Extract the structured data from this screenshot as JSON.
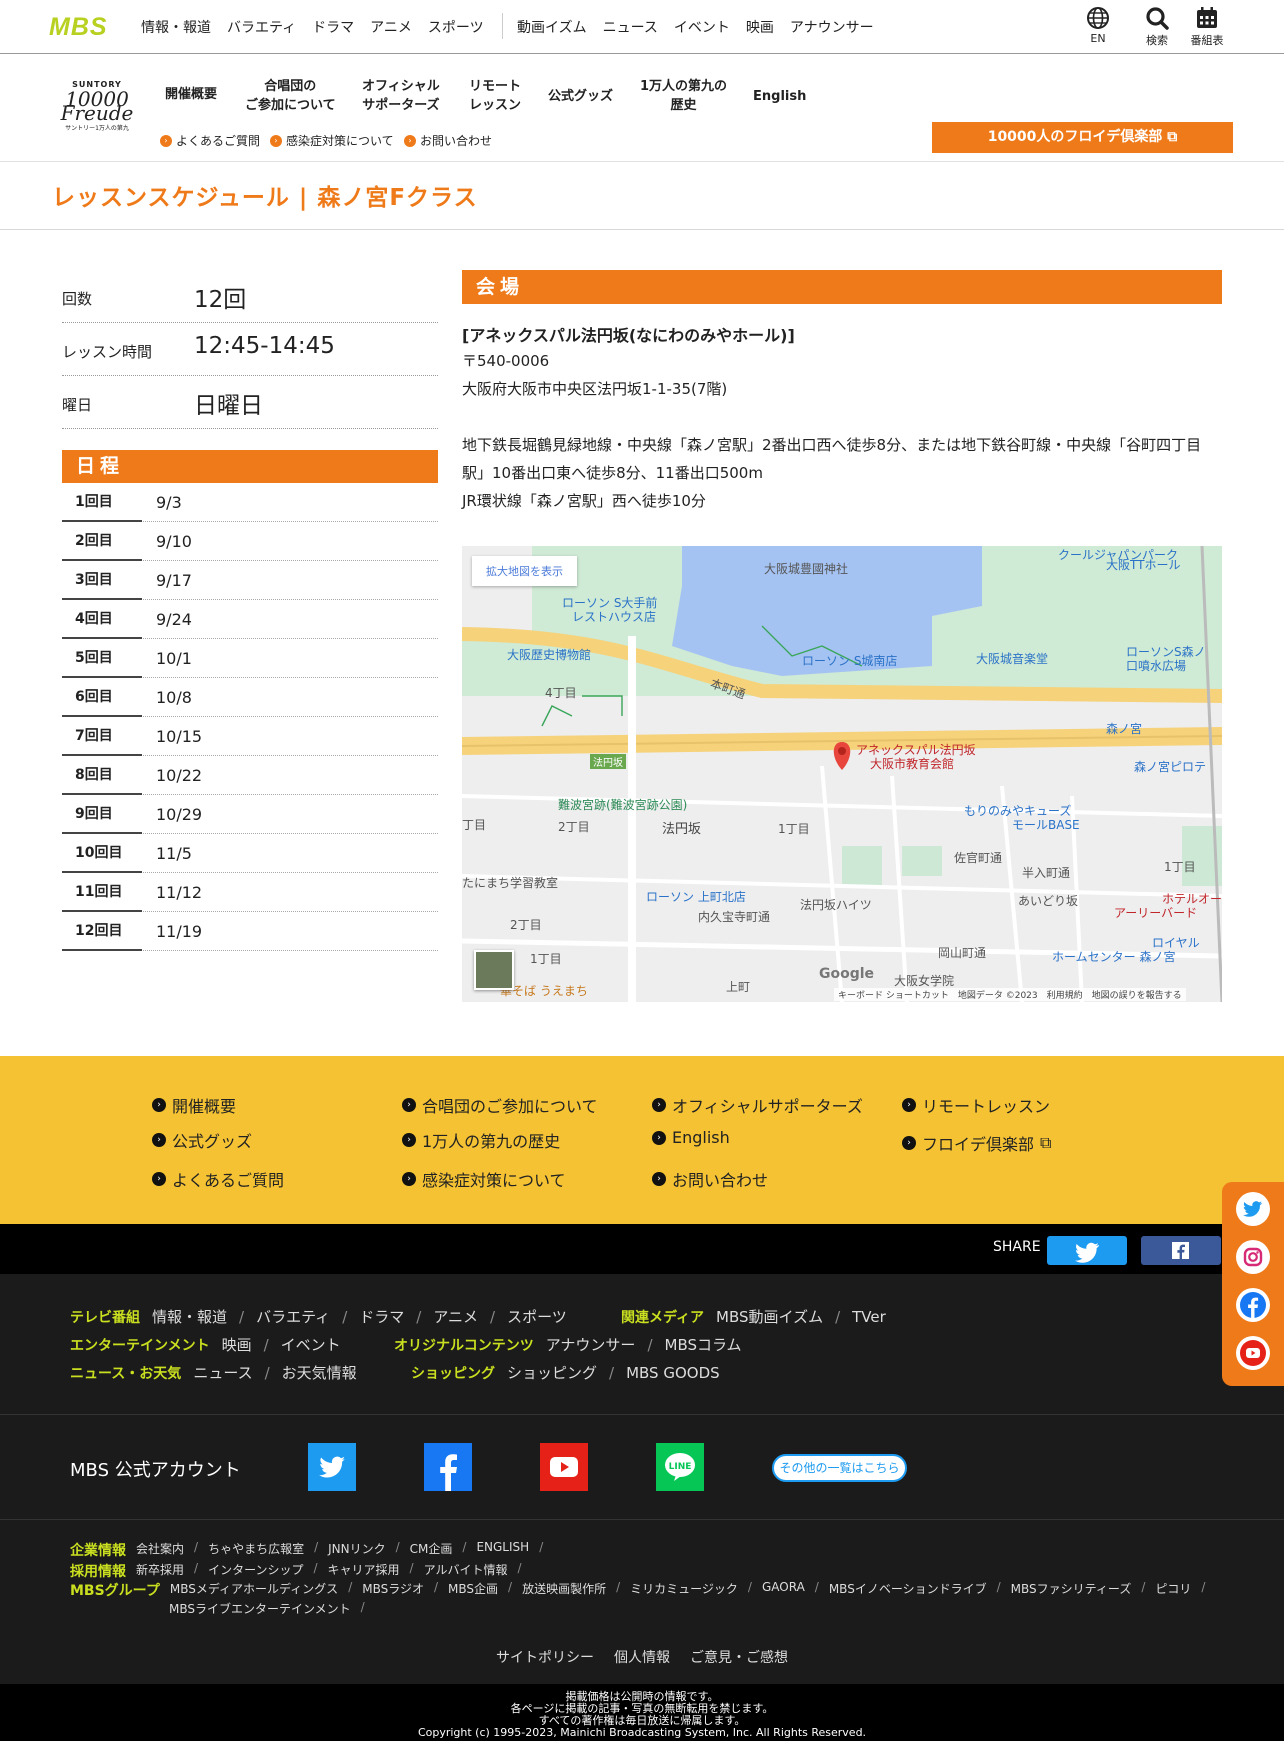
{
  "topbar": {
    "logo": "MBS",
    "nav1": [
      "情報・報道",
      "バラエティ",
      "ドラマ",
      "アニメ",
      "スポーツ"
    ],
    "nav2": [
      "動画イズム",
      "ニュース",
      "イベント",
      "映画",
      "アナウンサー"
    ],
    "tools": {
      "lang": "EN",
      "search": "検索",
      "schedule": "番組表"
    }
  },
  "brand": {
    "line1": "SUNTORY",
    "line2": "10000",
    "line3": "Freude",
    "line4": "サントリー1万人の第九"
  },
  "mainnav": [
    {
      "label1": "開催概要",
      "label2": ""
    },
    {
      "label1": "合唱団の",
      "label2": "ご参加について"
    },
    {
      "label1": "オフィシャル",
      "label2": "サポーターズ"
    },
    {
      "label1": "リモート",
      "label2": "レッスン"
    },
    {
      "label1": "公式グッズ",
      "label2": ""
    },
    {
      "label1": "1万人の第九の",
      "label2": "歴史"
    },
    {
      "label1": "English",
      "label2": ""
    }
  ],
  "subnav": [
    "よくあるご質問",
    "感染症対策について",
    "お問い合わせ"
  ],
  "club_button": "10000人のフロイデ倶楽部",
  "page_title": "レッスンスケジュール | 森ノ宮Fクラス",
  "info": {
    "count_label": "回数",
    "count_value": "12回",
    "time_label": "レッスン時間",
    "time_value": "12:45-14:45",
    "day_label": "曜日",
    "day_value": "日曜日"
  },
  "schedule": {
    "heading": "日程",
    "rows": [
      {
        "n": "1回目",
        "d": "9/3"
      },
      {
        "n": "2回目",
        "d": "9/10"
      },
      {
        "n": "3回目",
        "d": "9/17"
      },
      {
        "n": "4回目",
        "d": "9/24"
      },
      {
        "n": "5回目",
        "d": "10/1"
      },
      {
        "n": "6回目",
        "d": "10/8"
      },
      {
        "n": "7回目",
        "d": "10/15"
      },
      {
        "n": "8回目",
        "d": "10/22"
      },
      {
        "n": "9回目",
        "d": "10/29"
      },
      {
        "n": "10回目",
        "d": "11/5"
      },
      {
        "n": "11回目",
        "d": "11/12"
      },
      {
        "n": "12回目",
        "d": "11/19"
      }
    ]
  },
  "venue": {
    "heading": "会場",
    "name": "[アネックスパル法円坂(なにわのみやホール)]",
    "zip": "〒540-0006",
    "address": "大阪府大阪市中央区法円坂1-1-35(7階)",
    "access1": "地下鉄長堀鶴見緑地線・中央線「森ノ宮駅」2番出口西へ徒歩8分、または地下鉄谷町線・中央線「谷町四丁目駅」10番出口東へ徒歩8分、11番出口500m",
    "access2": "JR環状線「森ノ宮駅」西へ徒歩10分"
  },
  "map": {
    "open_button": "拡大地図を表示",
    "labels": {
      "shrine": "大阪城豊國神社",
      "coolj": "クールジャパンパーク",
      "tt": "大阪TTホール",
      "lawson1a": "ローソン S大手前",
      "lawson1b": "レストハウス店",
      "museum": "大阪歴史博物館",
      "lawson2": "ローソン S城南店",
      "music": "大阪城音楽堂",
      "lawson3a": "ローソンS森ノ",
      "lawson3b": "口噴水広場",
      "c4": "4丁目",
      "honmachi": "本町通",
      "morinomiya": "森ノ宮",
      "annex": "アネックスパル法円坂",
      "kyoiku": "大阪市教育会館",
      "houensaka_sign": "法円坂",
      "piloti": "森ノ宮ピロテ",
      "naniwa": "難波宮跡(難波宮跡公園)",
      "c2a": "2丁目",
      "houensaka": "法円坂",
      "c1a": "1丁目",
      "cues1": "もりのみやキューズ",
      "cues2": "モールBASE",
      "chome": "丁目",
      "tanimachi": "たにまち学習教室",
      "lawson4": "ローソン 上町北店",
      "haitsu": "法円坂ハイツ",
      "sakan": "佐官町通",
      "hannyu": "半入町通",
      "aidori": "あいどり坂",
      "uchikyu": "内久宝寺町通",
      "hotel1": "ホテルオー",
      "hotel2": "アーリーバード",
      "c2b": "2丁目",
      "c1b": "1丁目",
      "c1c": "1丁目",
      "okayama": "岡山町通",
      "royal1": "ロイヤル",
      "royal2": "ホームセンター 森ノ宮",
      "soba": "華そば うえまち",
      "uemachi": "上町",
      "joshi": "大阪女学院",
      "google": "Google",
      "attrib": "キーボード ショートカット　地図データ ©2023　利用規約　地図の誤りを報告する"
    }
  },
  "yellow_footer": {
    "col1": [
      "開催概要",
      "公式グッズ",
      "よくあるご質問"
    ],
    "col2": [
      "合唱団のご参加について",
      "1万人の第九の歴史",
      "感染症対策について"
    ],
    "col3": [
      "オフィシャルサポーターズ",
      "English",
      "お問い合わせ"
    ],
    "col4": [
      "リモートレッスン",
      "フロイデ倶楽部"
    ]
  },
  "share": {
    "label": "SHARE"
  },
  "footer": {
    "tv_cat": "テレビ番組",
    "tv_items": [
      "情報・報道",
      "バラエティ",
      "ドラマ",
      "アニメ",
      "スポーツ"
    ],
    "media_cat": "関連メディア",
    "media_items": [
      "MBS動画イズム",
      "TVer"
    ],
    "ent_cat": "エンターテインメント",
    "ent_items": [
      "映画",
      "イベント"
    ],
    "orig_cat": "オリジナルコンテンツ",
    "orig_items": [
      "アナウンサー",
      "MBSコラム"
    ],
    "news_cat": "ニュース・お天気",
    "news_items": [
      "ニュース",
      "お天気情報"
    ],
    "shop_cat": "ショッピング",
    "shop_items": [
      "ショッピング",
      "MBS GOODS"
    ],
    "official_label": "MBS 公式アカウント",
    "others_button": "その他の一覧はこちら",
    "corp_cat": "企業情報",
    "corp_items": [
      "会社案内",
      "ちゃやまち広報室",
      "JNNリンク",
      "CM企画",
      "ENGLISH"
    ],
    "recruit_cat": "採用情報",
    "recruit_items": [
      "新卒採用",
      "インターンシップ",
      "キャリア採用",
      "アルバイト情報"
    ],
    "group_cat": "MBSグループ",
    "group_items": [
      "MBSメディアホールディングス",
      "MBSラジオ",
      "MBS企画",
      "放送映画製作所",
      "ミリカミュージック",
      "GAORA",
      "MBSイノベーションドライブ",
      "MBSファシリティーズ",
      "ピコリ"
    ],
    "group_items2": [
      "MBSライブエンターテインメント"
    ],
    "policy": [
      "サイトポリシー",
      "個人情報",
      "ご意見・ご感想"
    ],
    "bottom": [
      "掲載価格は公開時の情報です。",
      "各ページに掲載の記事・写真の無断転用を禁じます。",
      "すべての著作権は毎日放送に帰属します。",
      "Copyright (c) 1995-2023, Mainichi Broadcasting System, Inc. All Rights Reserved."
    ]
  },
  "colors": {
    "accent": "#ef7a1a",
    "footer_yellow": "#f4c233",
    "footer_green": "#c9df1f"
  }
}
